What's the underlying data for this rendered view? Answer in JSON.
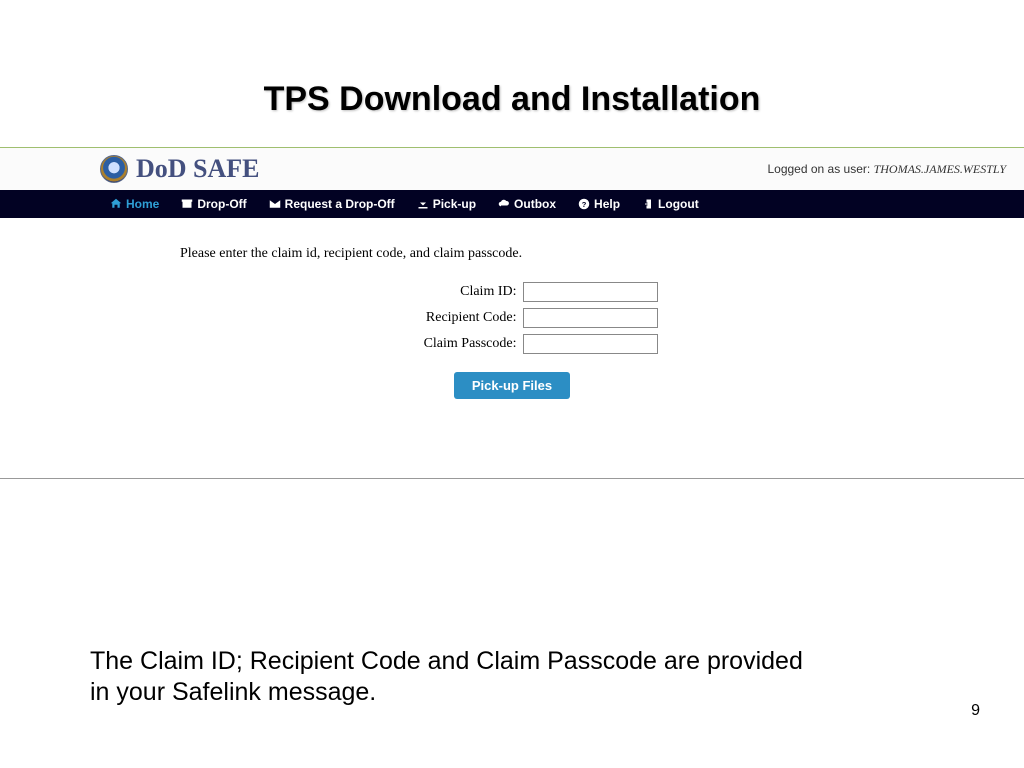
{
  "slide": {
    "title": "TPS Download and Installation",
    "caption": "The Claim ID; Recipient Code and Claim Passcode are provided in your Safelink message.",
    "page_number": "9"
  },
  "app": {
    "brand": "DoD SAFE",
    "user_prefix": "Logged on as user:",
    "user_name": "THOMAS.JAMES.WESTLY",
    "nav": {
      "home": "Home",
      "dropoff": "Drop-Off",
      "request": "Request a Drop-Off",
      "pickup": "Pick-up",
      "outbox": "Outbox",
      "help": "Help",
      "logout": "Logout"
    },
    "form": {
      "instruction": "Please enter the claim id, recipient code, and claim passcode.",
      "labels": {
        "claim_id": "Claim ID:",
        "recipient": "Recipient Code:",
        "passcode": "Claim Passcode:"
      },
      "values": {
        "claim_id": "",
        "recipient": "",
        "passcode": ""
      },
      "button": "Pick-up Files"
    }
  }
}
